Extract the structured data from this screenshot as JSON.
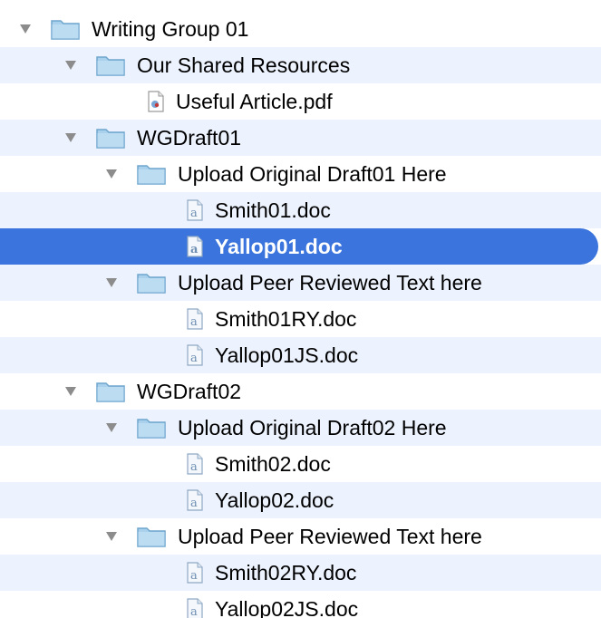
{
  "tree": {
    "items": [
      {
        "label": "Writing Group 01",
        "type": "folder",
        "expanded": true
      },
      {
        "label": "Our Shared Resources",
        "type": "folder",
        "expanded": true
      },
      {
        "label": "Useful Article.pdf",
        "type": "pdf"
      },
      {
        "label": "WGDraft01",
        "type": "folder",
        "expanded": true
      },
      {
        "label": "Upload Original Draft01 Here",
        "type": "folder",
        "expanded": true
      },
      {
        "label": "Smith01.doc",
        "type": "doc"
      },
      {
        "label": "Yallop01.doc",
        "type": "doc",
        "selected": true
      },
      {
        "label": "Upload Peer Reviewed Text here",
        "type": "folder",
        "expanded": true
      },
      {
        "label": "Smith01RY.doc",
        "type": "doc"
      },
      {
        "label": "Yallop01JS.doc",
        "type": "doc"
      },
      {
        "label": "WGDraft02",
        "type": "folder",
        "expanded": true
      },
      {
        "label": "Upload Original Draft02 Here",
        "type": "folder",
        "expanded": true
      },
      {
        "label": "Smith02.doc",
        "type": "doc"
      },
      {
        "label": "Yallop02.doc",
        "type": "doc"
      },
      {
        "label": "Upload Peer Reviewed Text here",
        "type": "folder",
        "expanded": true
      },
      {
        "label": "Smith02RY.doc",
        "type": "doc"
      },
      {
        "label": "Yallop02JS.doc",
        "type": "doc"
      }
    ]
  },
  "colors": {
    "alternate_row": "#edf3fe",
    "selection": "#3a74dc",
    "folder_fill": "#a9d0ec",
    "folder_stroke": "#6fa6cd",
    "disclosure_triangle": "#888888"
  },
  "icons": {
    "folder": "folder-icon",
    "doc": "document-icon",
    "pdf": "pdf-icon",
    "disclosure": "disclosure-triangle-icon"
  }
}
